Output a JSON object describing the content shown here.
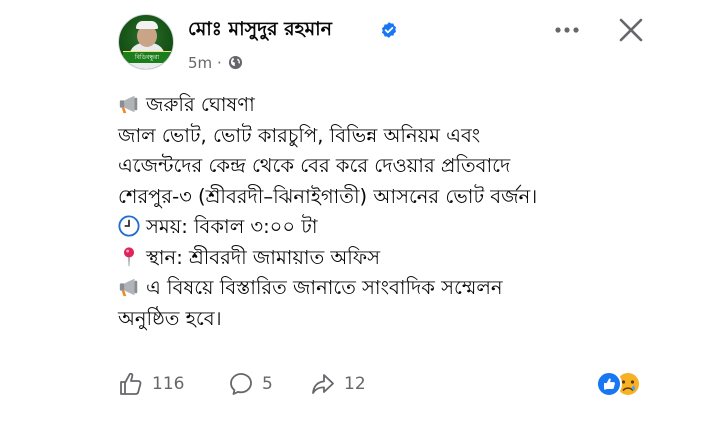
{
  "post": {
    "author": "মোঃ মাসুদুর রহমান",
    "timestamp": "5m",
    "privacy_icon": "globe-icon",
    "avatar_banner": "বিডিবন্ধুরা",
    "lines": [
      "জরুরি ঘোষণা",
      "জাল ভোট, ভোট কারচুপি, বিভিন্ন অনিয়ম এবং",
      "এজেন্টদের কেন্দ্র থেকে বের করে দেওয়ার প্রতিবাদে",
      "শেরপুর-৩ (শ্রীবরদী–ঝিনাইগাতী) আসনের ভোট বর্জন।",
      "সময়: বিকাল ৩:০০ টা",
      "স্থান: শ্রীবরদী জামায়াত অফিস",
      "এ বিষয়ে বিস্তারিত জানাতে সাংবাদিক সম্মেলন",
      "অনুষ্ঠিত হবে।"
    ],
    "line_icons": [
      "megaphone-icon",
      "",
      "",
      "",
      "clock-icon",
      "pin-icon",
      "megaphone-icon",
      ""
    ]
  },
  "footer": {
    "likes": "116",
    "comments": "5",
    "shares": "12",
    "reactions": [
      "like-reaction-icon",
      "sad-reaction-icon"
    ]
  },
  "colors": {
    "facebook_blue": "#1877F2",
    "muted_text": "#65676B",
    "sad_yellow": "#F7B125"
  }
}
